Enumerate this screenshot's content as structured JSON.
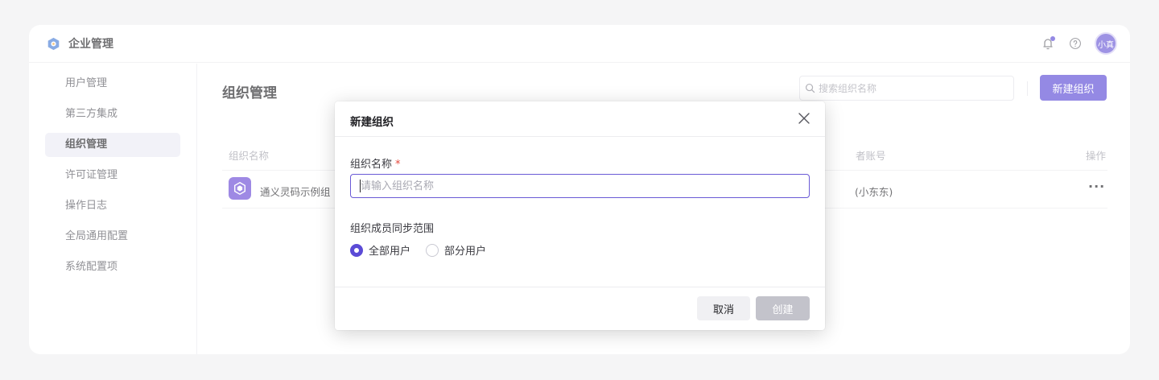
{
  "app": {
    "title": "企业管理",
    "accent": "#5b4bd6",
    "avatar_text": "小真"
  },
  "sidebar": {
    "items": [
      {
        "label": "用户管理"
      },
      {
        "label": "第三方集成"
      },
      {
        "label": "组织管理",
        "active": true
      },
      {
        "label": "许可证管理"
      },
      {
        "label": "操作日志"
      },
      {
        "label": "全局通用配置"
      },
      {
        "label": "系统配置项"
      }
    ]
  },
  "main": {
    "title": "组织管理",
    "search_placeholder": "搜索组织名称",
    "new_button": "新建组织",
    "columns": {
      "name": "组织名称",
      "owner": "者账号",
      "action": "操作"
    },
    "row": {
      "name": "通义灵码示例组",
      "owner": "(小东东)",
      "more": "···"
    }
  },
  "modal": {
    "title": "新建组织",
    "name_label": "组织名称",
    "required_mark": "*",
    "name_placeholder": "请输入组织名称",
    "sync_label": "组织成员同步范围",
    "options": [
      {
        "label": "全部用户",
        "checked": true
      },
      {
        "label": "部分用户",
        "checked": false
      }
    ],
    "cancel": "取消",
    "create": "创建"
  }
}
